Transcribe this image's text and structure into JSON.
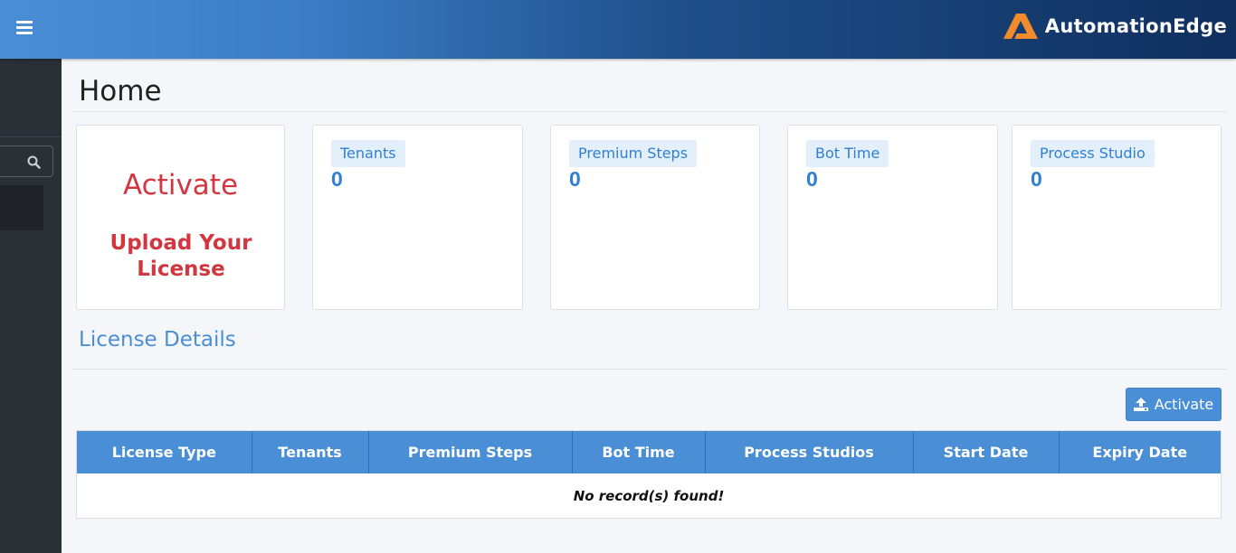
{
  "app": {
    "brand": "AutomationEdge",
    "accent_color": "#4a8fd6",
    "alert_color": "#d2373f"
  },
  "header": {
    "menu_icon": "hamburger-icon",
    "logo_icon": "automationedge-logo-icon"
  },
  "sidebar": {
    "search_icon": "search-icon"
  },
  "page": {
    "title": "Home"
  },
  "activate_card": {
    "title": "Activate",
    "subtitle": "Upload Your License"
  },
  "stats": [
    {
      "label": "Tenants",
      "value": "0"
    },
    {
      "label": "Premium Steps",
      "value": "0"
    },
    {
      "label": "Bot Time",
      "value": "0"
    },
    {
      "label": "Process Studio",
      "value": "0"
    }
  ],
  "license_details": {
    "title": "License Details",
    "activate_button": "Activate",
    "activate_icon": "upload-icon",
    "columns": [
      "License Type",
      "Tenants",
      "Premium Steps",
      "Bot Time",
      "Process Studios",
      "Start Date",
      "Expiry Date"
    ],
    "empty_message": "No record(s) found!"
  }
}
